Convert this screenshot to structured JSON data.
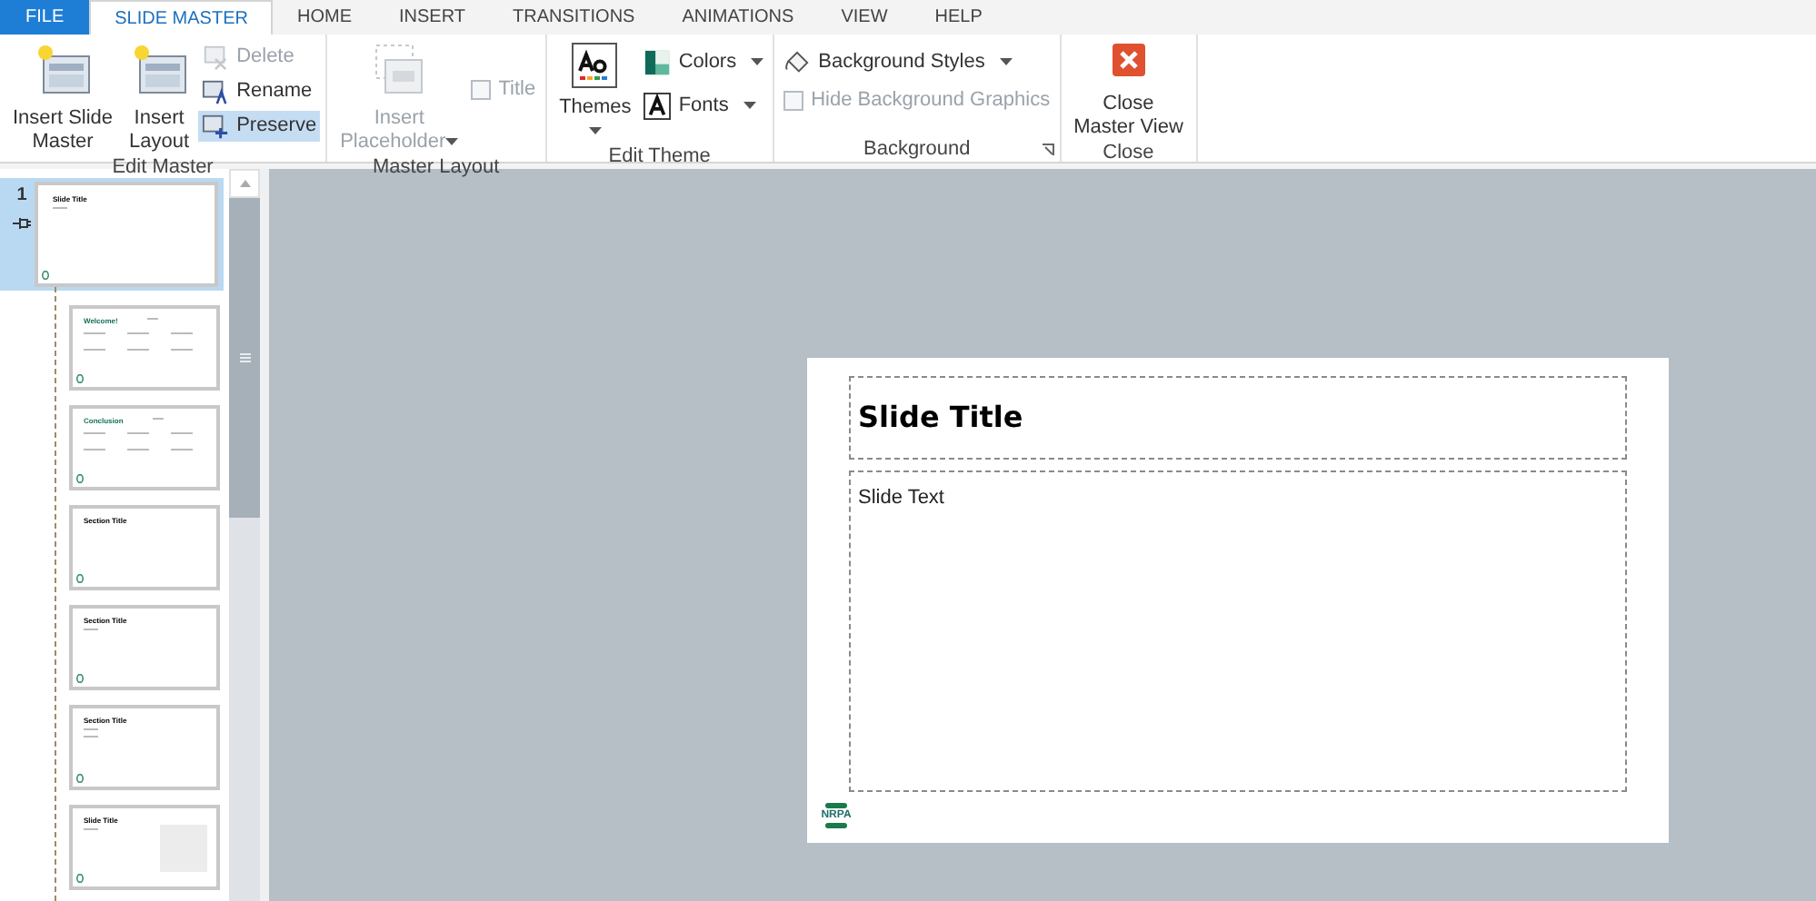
{
  "tabs": [
    {
      "label": "FILE",
      "kind": "file",
      "selected": false
    },
    {
      "label": "SLIDE MASTER",
      "kind": "tab",
      "selected": true
    },
    {
      "label": "HOME",
      "kind": "tab",
      "selected": false
    },
    {
      "label": "INSERT",
      "kind": "tab",
      "selected": false
    },
    {
      "label": "TRANSITIONS",
      "kind": "tab",
      "selected": false
    },
    {
      "label": "ANIMATIONS",
      "kind": "tab",
      "selected": false
    },
    {
      "label": "VIEW",
      "kind": "tab",
      "selected": false
    },
    {
      "label": "HELP",
      "kind": "tab",
      "selected": false
    }
  ],
  "ribbon": {
    "groups": [
      {
        "label": "Edit Master",
        "items": [
          {
            "kind": "large",
            "lines": [
              "Insert Slide",
              "Master"
            ],
            "disabled": false
          },
          {
            "kind": "large",
            "lines": [
              "Insert",
              "Layout"
            ],
            "disabled": false
          },
          {
            "kind": "stack",
            "items": [
              {
                "kind": "small",
                "label": "Delete",
                "disabled": true,
                "selected": false
              },
              {
                "kind": "small",
                "label": "Rename",
                "disabled": false,
                "selected": false
              },
              {
                "kind": "small",
                "label": "Preserve",
                "disabled": false,
                "selected": true
              }
            ]
          }
        ]
      },
      {
        "label": "Master Layout",
        "items": [
          {
            "kind": "large",
            "lines": [
              "Insert",
              "Placeholder"
            ],
            "disabled": true,
            "dropdown": true
          },
          {
            "kind": "stack",
            "items": [
              {
                "kind": "checkbox",
                "label": "Title",
                "disabled": true,
                "checked": false
              }
            ]
          }
        ]
      },
      {
        "label": "Edit Theme",
        "items": [
          {
            "kind": "large",
            "lines": [
              "Themes"
            ],
            "disabled": false,
            "dropdown": true
          },
          {
            "kind": "stack",
            "items": [
              {
                "kind": "dropdown",
                "label": "Colors",
                "disabled": false
              },
              {
                "kind": "dropdown",
                "label": "Fonts",
                "disabled": false
              }
            ]
          }
        ]
      },
      {
        "label": "Background",
        "launcher": true,
        "items": [
          {
            "kind": "stack",
            "items": [
              {
                "kind": "dropdown",
                "label": "Background Styles",
                "disabled": false
              },
              {
                "kind": "checkbox",
                "label": "Hide Background Graphics",
                "disabled": true,
                "checked": false
              }
            ]
          }
        ]
      },
      {
        "label": "Close",
        "items": [
          {
            "kind": "large",
            "lines": [
              "Close",
              "Master View"
            ],
            "disabled": false
          }
        ]
      }
    ]
  },
  "slides": [
    {
      "kind": "master",
      "number": "1",
      "title": "Slide Title",
      "selected": true
    },
    {
      "kind": "cards",
      "title": "Welcome!",
      "selected": false
    },
    {
      "kind": "cards",
      "title": "Conclusion",
      "selected": false
    },
    {
      "kind": "title",
      "title": "Section Title",
      "selected": false
    },
    {
      "kind": "title-text",
      "title": "Section Title",
      "selected": false
    },
    {
      "kind": "title-2text",
      "title": "Section Title",
      "selected": false
    },
    {
      "kind": "title-picture",
      "title": "Slide Title",
      "selected": false
    }
  ],
  "slide": {
    "title": "Slide Title",
    "text": "Slide Text",
    "logo": "NRPA"
  }
}
